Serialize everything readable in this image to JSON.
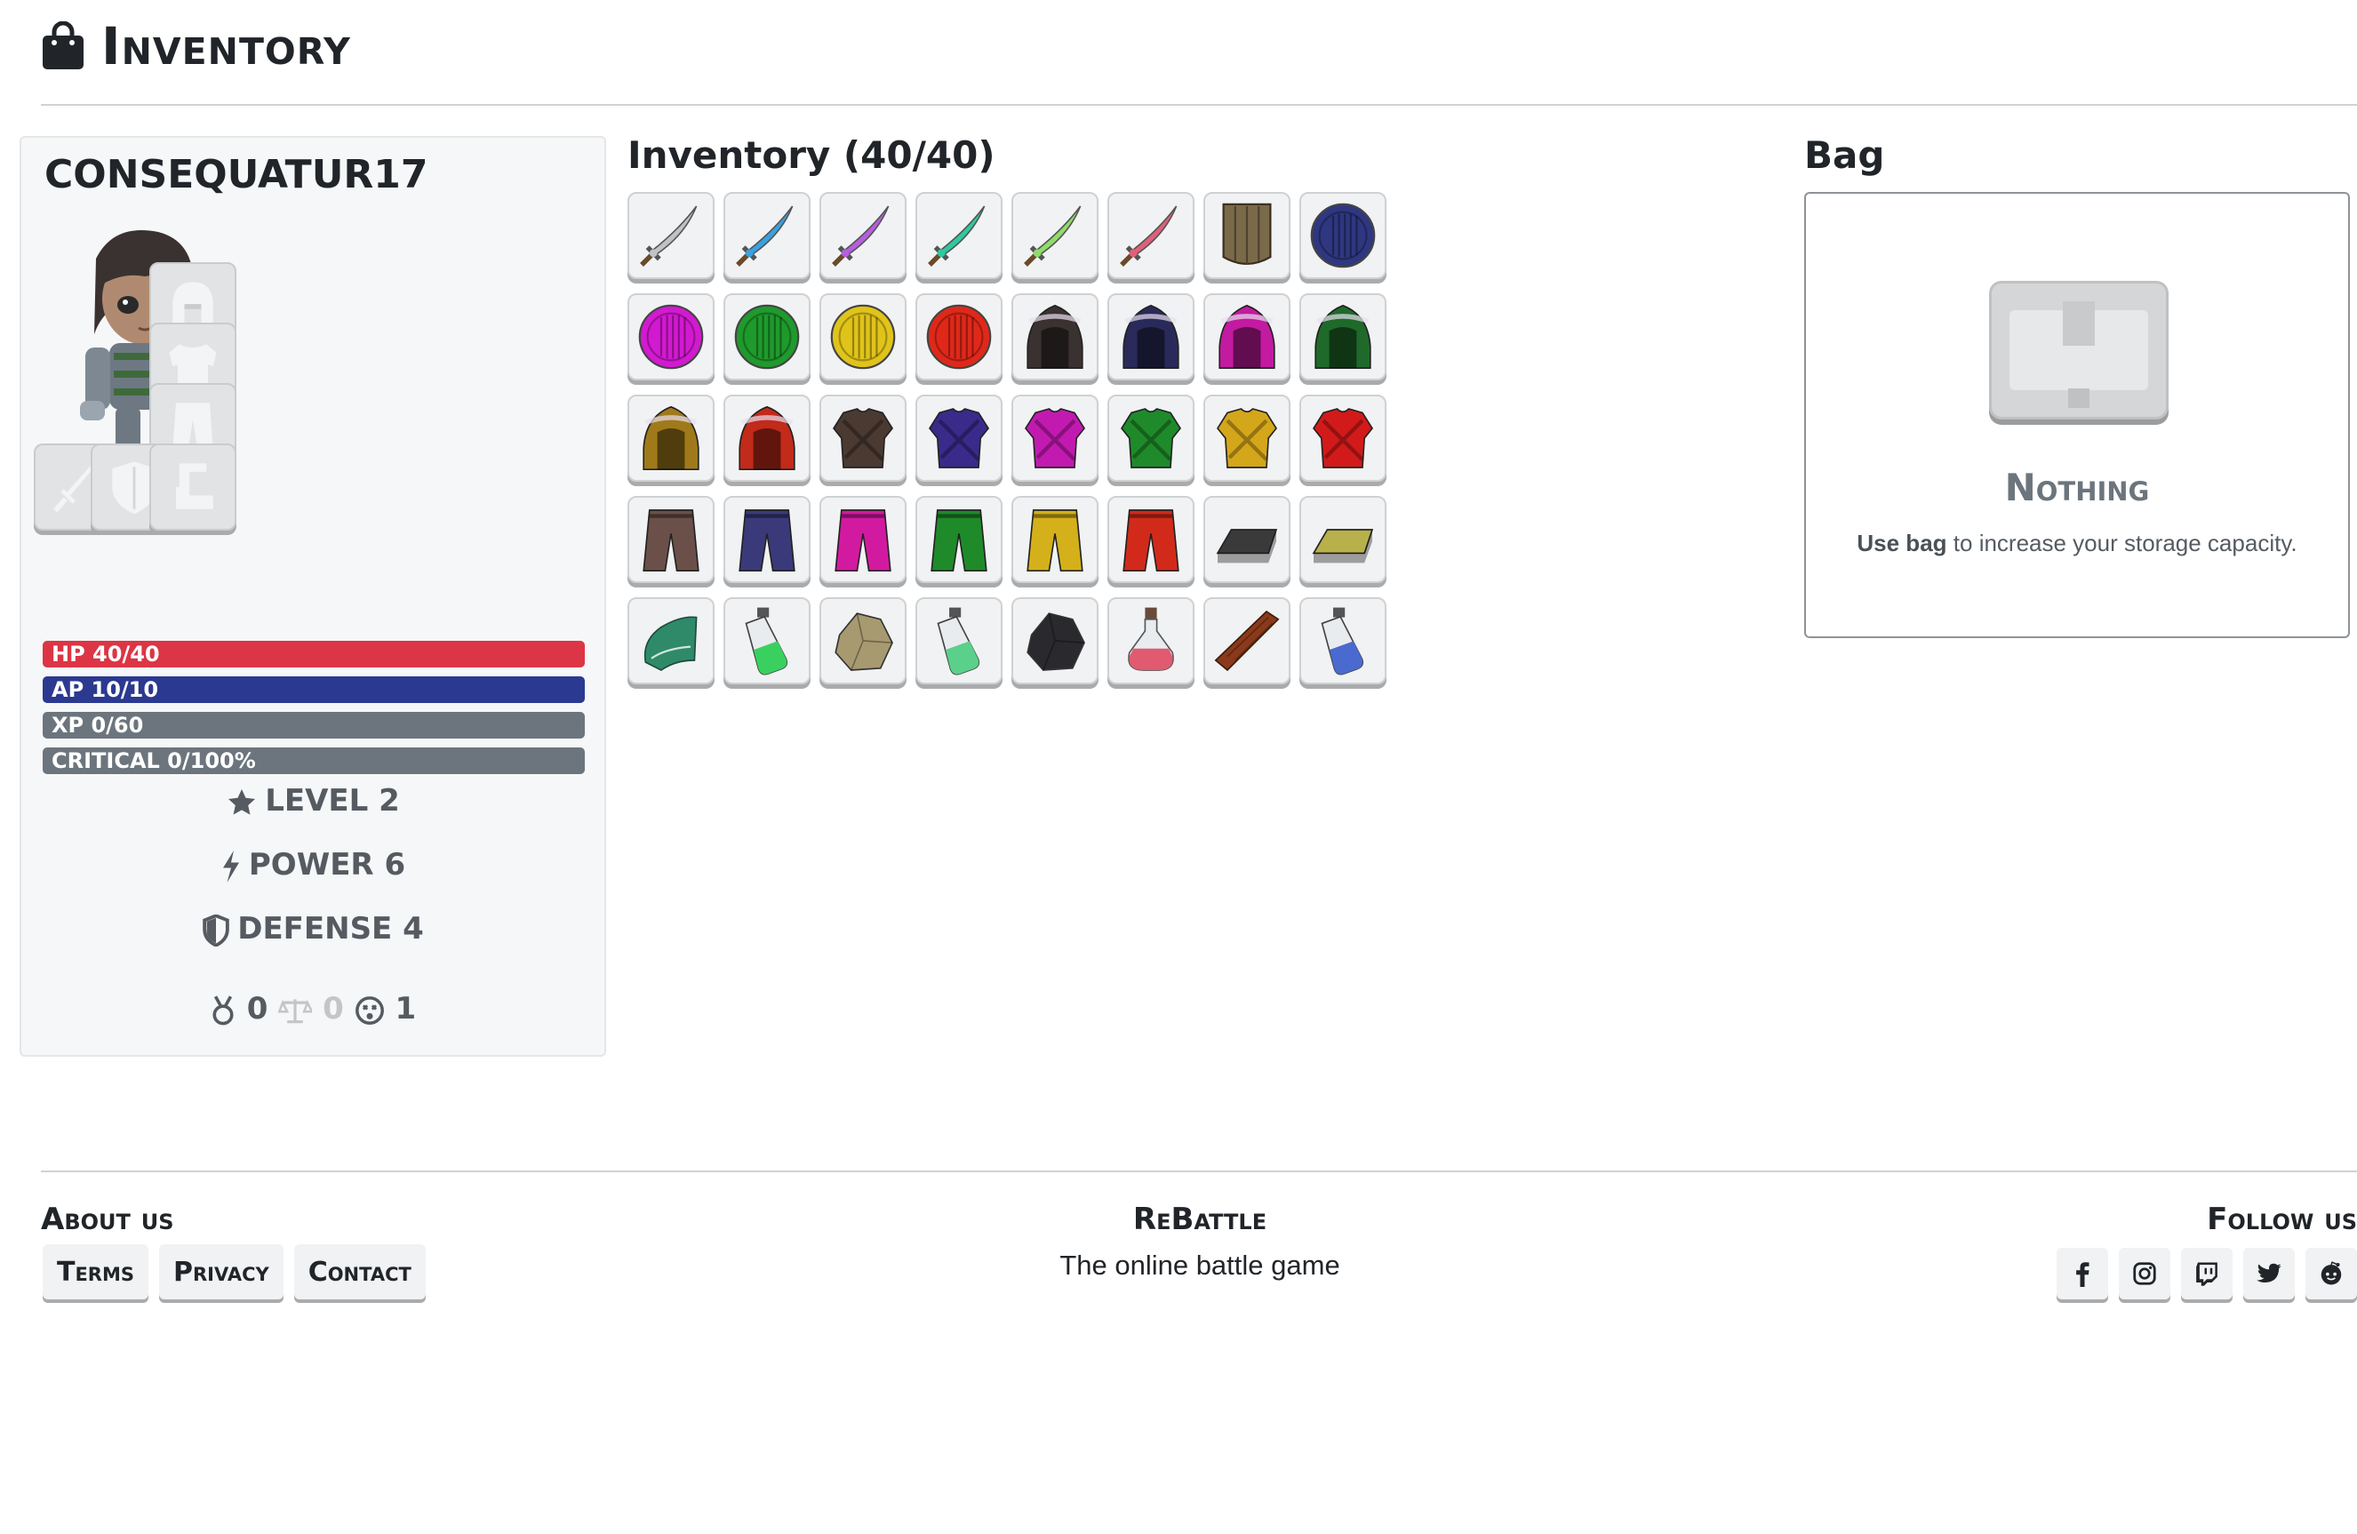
{
  "header": {
    "title": "Inventory",
    "icon": "shopping-bag-icon"
  },
  "character": {
    "name": "CONSEQUATUR17",
    "equipment_slots": [
      {
        "name": "helmet-slot",
        "icon": "helmet-icon"
      },
      {
        "name": "armor-slot",
        "icon": "shirt-icon"
      },
      {
        "name": "pants-slot",
        "icon": "pants-icon"
      },
      {
        "name": "weapon-slot",
        "icon": "sword-icon"
      },
      {
        "name": "shield-slot",
        "icon": "shield-icon"
      },
      {
        "name": "boots-slot",
        "icon": "boot-icon"
      }
    ],
    "bars": [
      {
        "label": "HP 40/40",
        "fraction": 1.0,
        "color": "#dc3545"
      },
      {
        "label": "AP 10/10",
        "fraction": 1.0,
        "color": "#2b3990"
      },
      {
        "label": "XP 0/60",
        "fraction": 0.0,
        "color": "#6c757d"
      },
      {
        "label": "CRITICAL 0/100%",
        "fraction": 0.0,
        "color": "#6c757d"
      }
    ],
    "level_label": "LEVEL 2",
    "power_label": "POWER 6",
    "defense_label": "DEFENSE 4",
    "medals": {
      "wins": "0",
      "draws": "0",
      "losses": "1"
    }
  },
  "inventory": {
    "title": "Inventory (40/40)",
    "items": [
      {
        "kind": "sword",
        "color": "#bfc3c6"
      },
      {
        "kind": "sword",
        "color": "#3aa0e0"
      },
      {
        "kind": "sword",
        "color": "#b65ee0"
      },
      {
        "kind": "sword",
        "color": "#2fc9a0"
      },
      {
        "kind": "sword",
        "color": "#8fdc6a"
      },
      {
        "kind": "sword",
        "color": "#e0607a"
      },
      {
        "kind": "wood-shield",
        "color": "#7a6a4a"
      },
      {
        "kind": "round-shield",
        "color": "#2f3780"
      },
      {
        "kind": "round-shield",
        "color": "#d21ad0"
      },
      {
        "kind": "round-shield",
        "color": "#1f9a2c"
      },
      {
        "kind": "round-shield",
        "color": "#e0c41a"
      },
      {
        "kind": "round-shield",
        "color": "#e0281a"
      },
      {
        "kind": "hood",
        "color": "#3a3230"
      },
      {
        "kind": "hood",
        "color": "#2a2a5a"
      },
      {
        "kind": "hood",
        "color": "#c21aa0"
      },
      {
        "kind": "hood",
        "color": "#1f6a2a"
      },
      {
        "kind": "hood",
        "color": "#a07a1a"
      },
      {
        "kind": "hood",
        "color": "#c22a1a"
      },
      {
        "kind": "armor",
        "color": "#4a3a32"
      },
      {
        "kind": "armor",
        "color": "#3a2a8a"
      },
      {
        "kind": "armor",
        "color": "#c21ab0"
      },
      {
        "kind": "armor",
        "color": "#1f8a2a"
      },
      {
        "kind": "armor",
        "color": "#d4a61a"
      },
      {
        "kind": "armor",
        "color": "#d21a1a"
      },
      {
        "kind": "pants",
        "color": "#6a5048"
      },
      {
        "kind": "pants",
        "color": "#3a3a7a"
      },
      {
        "kind": "pants",
        "color": "#d21aa0"
      },
      {
        "kind": "pants",
        "color": "#1f8a2a"
      },
      {
        "kind": "pants",
        "color": "#d4b01a"
      },
      {
        "kind": "pants",
        "color": "#d22a1a"
      },
      {
        "kind": "ingot",
        "color": "#3a3a3a"
      },
      {
        "kind": "ingot",
        "color": "#b8b04a"
      },
      {
        "kind": "cloth",
        "color": "#2f8a6a"
      },
      {
        "kind": "potion",
        "color": "#3ad060"
      },
      {
        "kind": "rock",
        "color": "#a89a70"
      },
      {
        "kind": "potion",
        "color": "#5ad08a"
      },
      {
        "kind": "rock",
        "color": "#2a2a2e"
      },
      {
        "kind": "flask",
        "color": "#e05a70"
      },
      {
        "kind": "plank",
        "color": "#8a3a1a"
      },
      {
        "kind": "potion",
        "color": "#4a6ad0"
      }
    ]
  },
  "bag": {
    "title": "Bag",
    "empty_label": "Nothing",
    "hint_bold": "Use bag",
    "hint_rest": "to increase your storage capacity."
  },
  "footer": {
    "about_title": "About us",
    "links": [
      "Terms",
      "Privacy",
      "Contact"
    ],
    "brand": "ReBattle",
    "tagline": "The online battle game",
    "follow_title": "Follow us",
    "social": [
      "facebook-icon",
      "instagram-icon",
      "twitch-icon",
      "twitter-icon",
      "reddit-icon"
    ]
  }
}
